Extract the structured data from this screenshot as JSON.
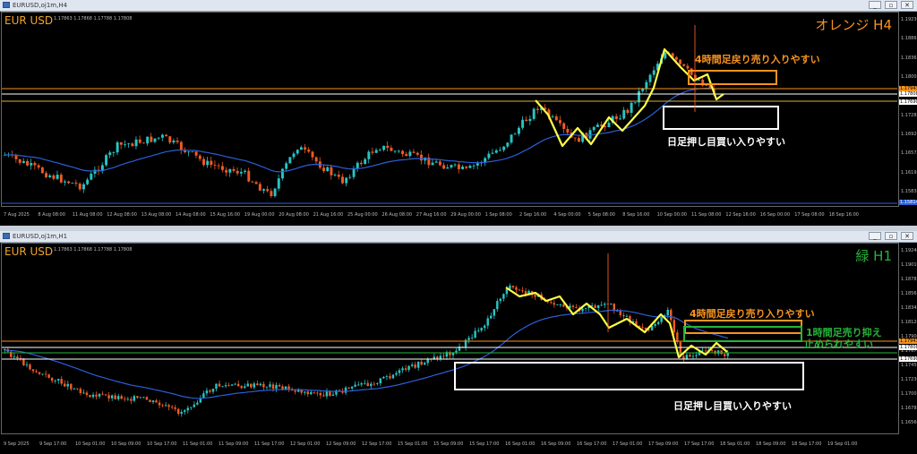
{
  "colors": {
    "accent_orange": "#f7931e",
    "green": "#27b33a",
    "yellow": "#ffff46",
    "ma_blue": "#2b5fd9",
    "candle_up": "#26c4c4",
    "candle_down": "#f05a24",
    "frame_white": "#ffffff"
  },
  "top": {
    "title": "EURUSD,oj1m,H4",
    "symbol": "EUR USD",
    "ohlc": "1.17863 1.17868 1.17788 1.17808",
    "timeframe": "オレンジ H4",
    "note_sell": "4時間足戻り売り入りやすい",
    "note_buy": "日足押し目買い入りやすい",
    "price_ticks": [
      "1.19230",
      "1.18865",
      "1.18365",
      "1.18003",
      "1.17640",
      "1.17283",
      "1.16920",
      "1.16575",
      "1.16195",
      "1.15834"
    ],
    "price_boxes": [
      "1.17943",
      "1.17808",
      "1.17690",
      "1.15814"
    ],
    "time_ticks": [
      "7 Aug 2025",
      "8 Aug 08:00",
      "11 Aug 08:00",
      "12 Aug 08:00",
      "13 Aug 08:00",
      "14 Aug 08:00",
      "15 Aug 16:00",
      "19 Aug 00:00",
      "20 Aug 08:00",
      "21 Aug 16:00",
      "25 Aug 00:00",
      "26 Aug 08:00",
      "27 Aug 16:00",
      "29 Aug 00:00",
      "1 Sep 08:00",
      "2 Sep 16:00",
      "4 Sep 00:00",
      "5 Sep 08:00",
      "8 Sep 16:00",
      "10 Sep 00:00",
      "11 Sep 08:00",
      "12 Sep 16:00",
      "16 Sep 00:00",
      "17 Sep 08:00",
      "18 Sep 16:00"
    ]
  },
  "bottom": {
    "title": "EURUSD,oj1m,H1",
    "symbol": "EUR USD",
    "ohlc": "1.17863 1.17868 1.17788 1.17808",
    "timeframe": "緑 H1",
    "note_sell": "4時間足戻り売り入りやすい",
    "note_hold": "1時間足売り抑え\n止められやすい",
    "note_buy": "日足押し目買い入りやすい",
    "price_ticks": [
      "1.19240",
      "1.19010",
      "1.18785",
      "1.18565",
      "1.18345",
      "1.18120",
      "1.17900",
      "1.17675",
      "1.17450",
      "1.17230",
      "1.17005",
      "1.16785",
      "1.16560"
    ],
    "price_boxes": [
      "1.17943",
      "1.17808",
      "1.17690"
    ],
    "time_ticks": [
      "9 Sep 2025",
      "9 Sep 17:00",
      "10 Sep 01:00",
      "10 Sep 09:00",
      "10 Sep 17:00",
      "11 Sep 01:00",
      "11 Sep 09:00",
      "11 Sep 17:00",
      "12 Sep 01:00",
      "12 Sep 09:00",
      "12 Sep 17:00",
      "15 Sep 01:00",
      "15 Sep 09:00",
      "15 Sep 17:00",
      "16 Sep 01:00",
      "16 Sep 09:00",
      "16 Sep 17:00",
      "17 Sep 01:00",
      "17 Sep 09:00",
      "17 Sep 17:00",
      "18 Sep 01:00",
      "18 Sep 09:00",
      "18 Sep 17:00",
      "19 Sep 01:00"
    ]
  }
}
